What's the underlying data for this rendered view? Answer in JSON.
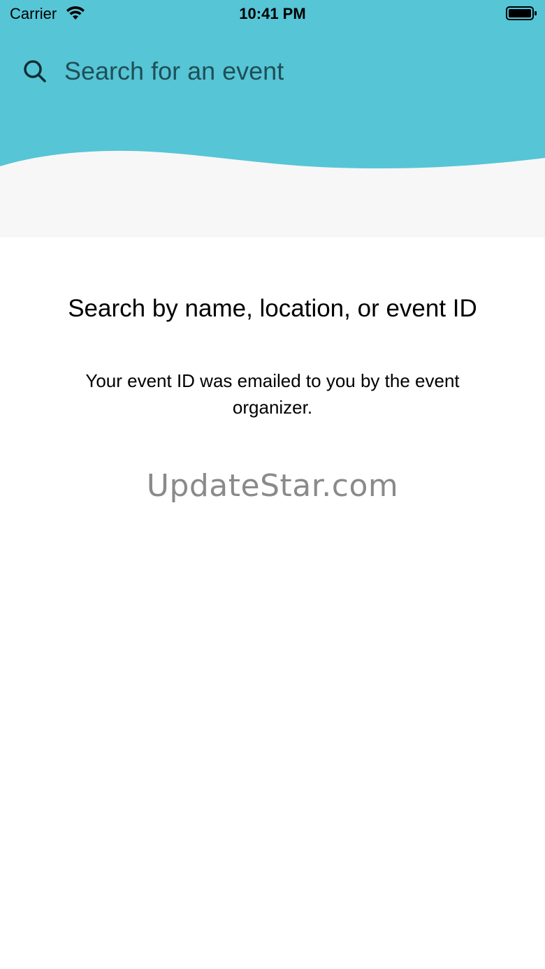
{
  "status_bar": {
    "carrier": "Carrier",
    "time": "10:41 PM"
  },
  "search": {
    "placeholder": "Search for an event"
  },
  "empty_state": {
    "title": "Search by name, location, or event ID",
    "subtitle": "Your event ID was emailed to you by the event organizer."
  },
  "watermark": "UpdateStar.com",
  "colors": {
    "header_teal": "#56c5d6",
    "header_strip": "#f7f7f7",
    "background": "#ffffff",
    "search_text": "#1f4f57",
    "watermark": "#8a8a8a"
  },
  "icons": {
    "status_wifi": "wifi-icon",
    "status_battery": "battery-icon",
    "search": "search-icon"
  }
}
